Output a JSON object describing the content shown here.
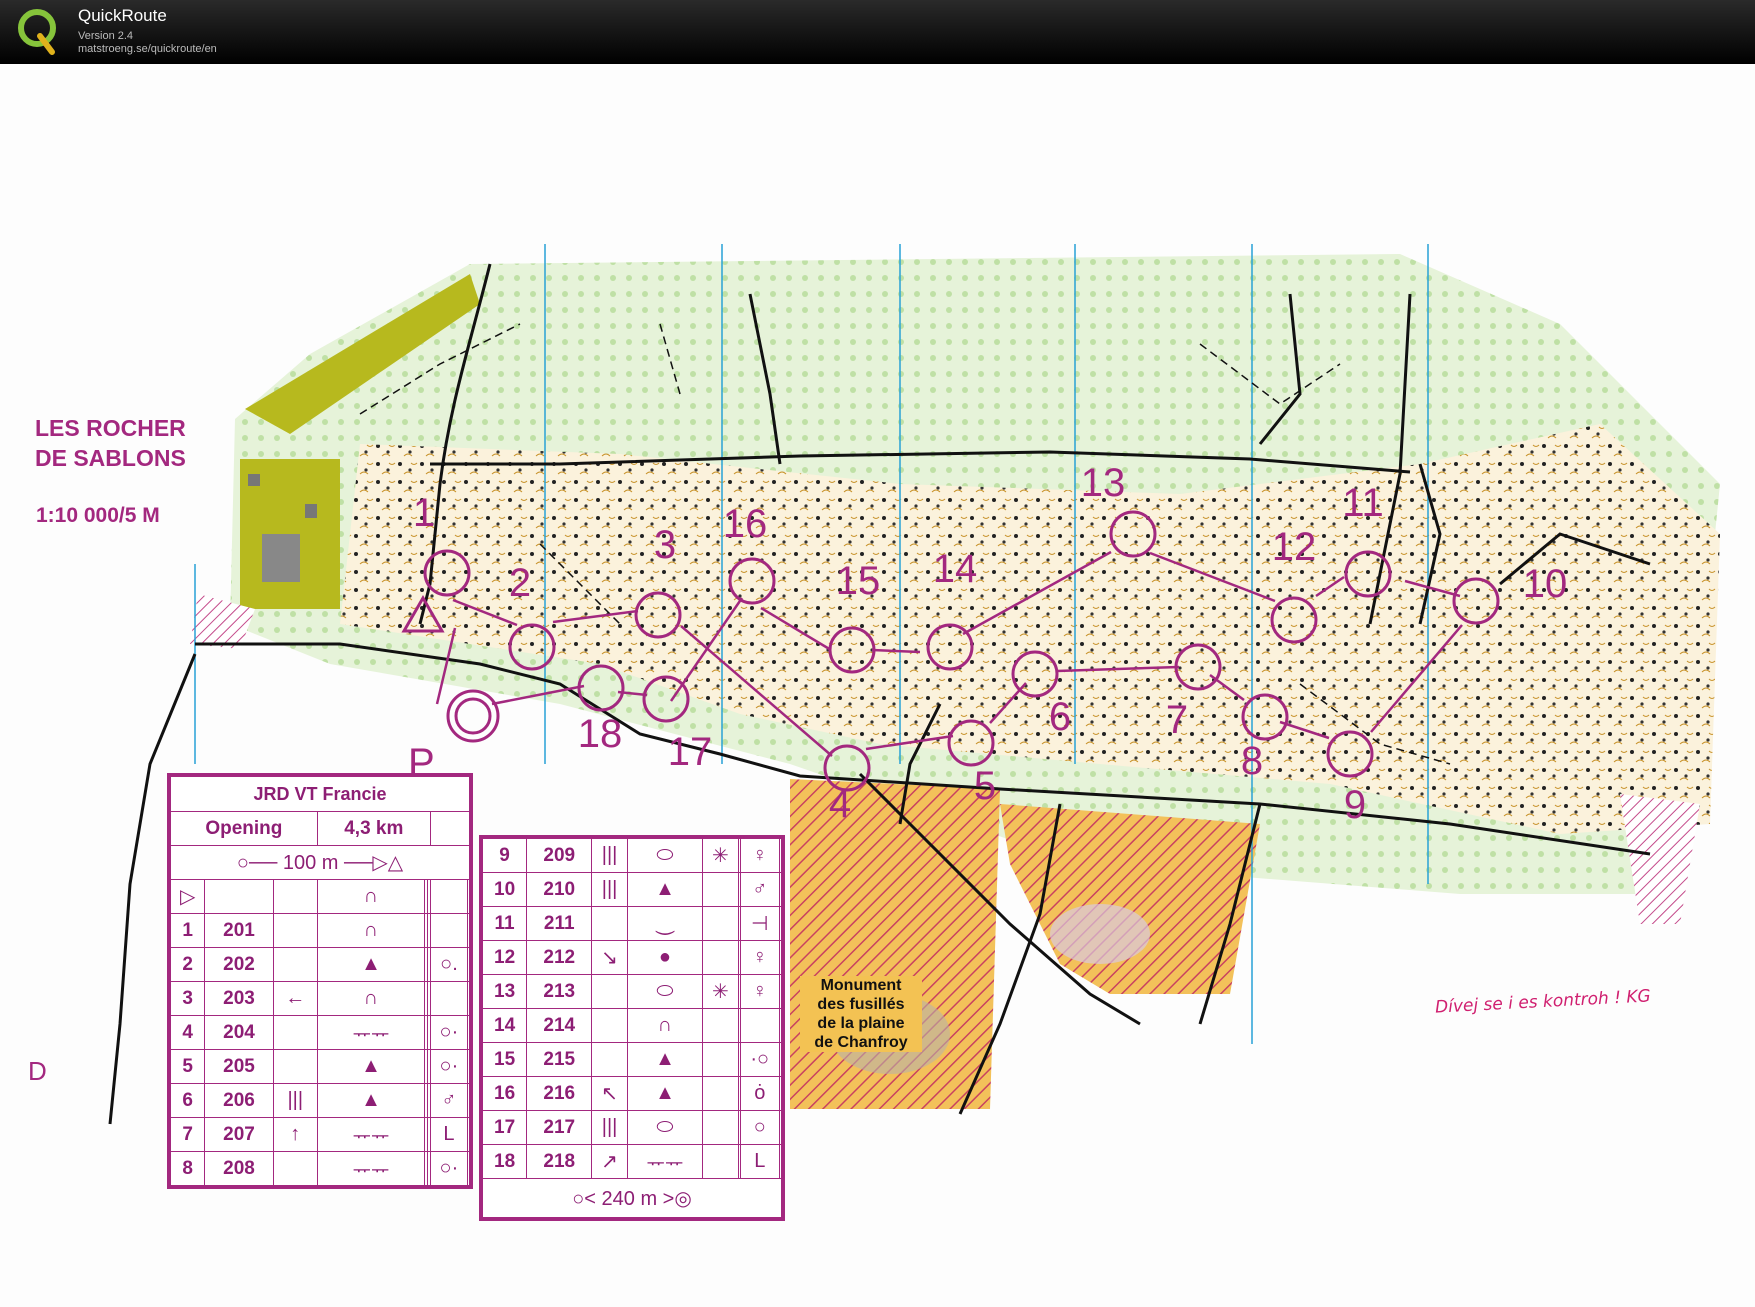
{
  "app": {
    "title": "QuickRoute",
    "version": "Version 2.4",
    "url": "matstroeng.se/quickroute/en"
  },
  "map": {
    "title_line1": "LES ROCHER",
    "title_line2": "DE SABLONS",
    "scale": "1:10 000/5 M",
    "monument_label": [
      "Monument",
      "des fusillés",
      "de la plaine",
      "de Chanfroy"
    ],
    "handwritten_note": "Dívej se i es kontroh ! KG",
    "start_letter": "P",
    "corner_letter": "D"
  },
  "controls": [
    {
      "label": "1"
    },
    {
      "label": "2"
    },
    {
      "label": "3"
    },
    {
      "label": "4"
    },
    {
      "label": "5"
    },
    {
      "label": "6"
    },
    {
      "label": "7"
    },
    {
      "label": "8"
    },
    {
      "label": "9"
    },
    {
      "label": "10"
    },
    {
      "label": "11"
    },
    {
      "label": "12"
    },
    {
      "label": "13"
    },
    {
      "label": "14"
    },
    {
      "label": "15"
    },
    {
      "label": "16"
    },
    {
      "label": "17"
    },
    {
      "label": "18"
    }
  ],
  "description_sheet": {
    "event": "JRD VT Francie",
    "class": "Opening",
    "length": "4,3 km",
    "start_to_first": "100 m",
    "finish_distance": "240 m",
    "left_rows": [
      {
        "num": "1",
        "code": "201",
        "c3": "",
        "c4": "∩",
        "c7": ""
      },
      {
        "num": "2",
        "code": "202",
        "c3": "",
        "c4": "▲",
        "c7": "○."
      },
      {
        "num": "3",
        "code": "203",
        "c3": "←",
        "c4": "∩",
        "c7": ""
      },
      {
        "num": "4",
        "code": "204",
        "c3": "",
        "c4": "ᅲᅲ",
        "c7": "○·"
      },
      {
        "num": "5",
        "code": "205",
        "c3": "",
        "c4": "▲",
        "c7": "○·"
      },
      {
        "num": "6",
        "code": "206",
        "c3": "|||",
        "c4": "▲",
        "c7": "♂"
      },
      {
        "num": "7",
        "code": "207",
        "c3": "↑",
        "c4": "ᅲᅲ",
        "c7": "L"
      },
      {
        "num": "8",
        "code": "208",
        "c3": "",
        "c4": "ᅲᅲ",
        "c7": "○·"
      }
    ],
    "right_rows": [
      {
        "num": "9",
        "code": "209",
        "c3": "|||",
        "c4": "⬭",
        "c5": "✳",
        "c7": "♀"
      },
      {
        "num": "10",
        "code": "210",
        "c3": "|||",
        "c4": "▲",
        "c5": "",
        "c7": "♂"
      },
      {
        "num": "11",
        "code": "211",
        "c3": "",
        "c4": "⏝",
        "c5": "",
        "c7": "⊣"
      },
      {
        "num": "12",
        "code": "212",
        "c3": "↘",
        "c4": "●",
        "c5": "",
        "c7": "♀"
      },
      {
        "num": "13",
        "code": "213",
        "c3": "",
        "c4": "⬭",
        "c5": "✳",
        "c7": "♀"
      },
      {
        "num": "14",
        "code": "214",
        "c3": "",
        "c4": "∩",
        "c5": "",
        "c7": ""
      },
      {
        "num": "15",
        "code": "215",
        "c3": "",
        "c4": "▲",
        "c5": "",
        "c7": "·○"
      },
      {
        "num": "16",
        "code": "216",
        "c3": "↖",
        "c4": "▲",
        "c5": "",
        "c7": "ȯ"
      },
      {
        "num": "17",
        "code": "217",
        "c3": "|||",
        "c4": "⬭",
        "c5": "",
        "c7": "○"
      },
      {
        "num": "18",
        "code": "218",
        "c3": "↗",
        "c4": "ᅲᅲ",
        "c5": "",
        "c7": "L"
      }
    ]
  },
  "colors": {
    "course": "#a3287f",
    "olive_area": "#b7b91e",
    "orange_area": "#f2b24a"
  }
}
